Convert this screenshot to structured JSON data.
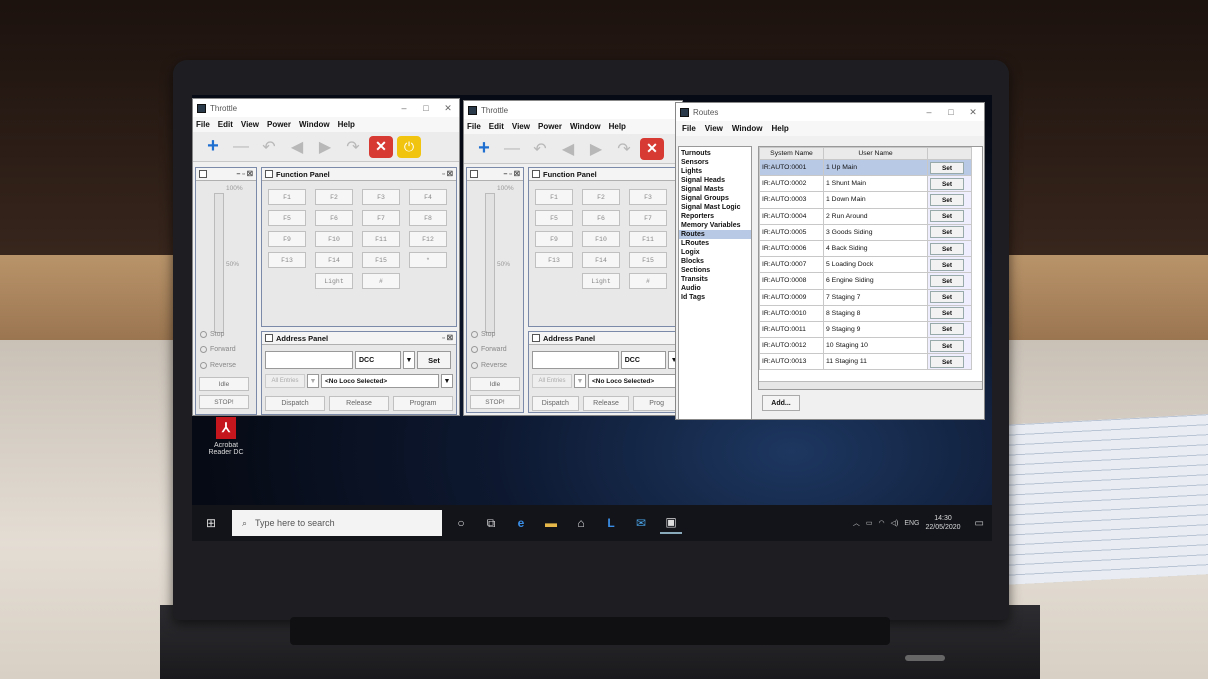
{
  "throttle1": {
    "title": "Throttle",
    "menu": [
      "File",
      "Edit",
      "View",
      "Power",
      "Window",
      "Help"
    ],
    "function_panel": {
      "title": "Function Panel",
      "buttons": [
        "F1",
        "F2",
        "F3",
        "F4",
        "F5",
        "F6",
        "F7",
        "F8",
        "F9",
        "F10",
        "F11",
        "F12",
        "F13",
        "F14",
        "F15",
        "*",
        "Light",
        "#"
      ]
    },
    "speed": {
      "top": "100%",
      "mid": "50%",
      "stop": "Stop"
    },
    "direction": {
      "forward": "Forward",
      "reverse": "Reverse"
    },
    "idle": "Idle",
    "stop_btn": "STOP!",
    "address_panel": {
      "title": "Address Panel",
      "protocol": "DCC",
      "set": "Set",
      "all_entries": "All Entries",
      "loco_select": "<No Loco Selected>",
      "dispatch": "Dispatch",
      "release": "Release",
      "program": "Program"
    }
  },
  "throttle2": {
    "title": "Throttle",
    "menu": [
      "File",
      "Edit",
      "View",
      "Power",
      "Window",
      "Help"
    ],
    "function_panel": {
      "title": "Function Panel",
      "buttons": [
        "F1",
        "F2",
        "F3",
        "F5",
        "F6",
        "F7",
        "F9",
        "F10",
        "F11",
        "F13",
        "F14",
        "F15",
        "Light",
        "#"
      ]
    },
    "speed": {
      "top": "100%",
      "mid": "50%",
      "stop": "Stop"
    },
    "direction": {
      "forward": "Forward",
      "reverse": "Reverse"
    },
    "idle": "Idle",
    "stop_btn": "STOP!",
    "address_panel": {
      "title": "Address Panel",
      "protocol": "DCC",
      "all_entries": "All Entries",
      "loco_select": "<No Loco Selected>",
      "dispatch": "Dispatch",
      "release": "Release",
      "program": "Prog"
    }
  },
  "routes": {
    "title": "Routes",
    "menu": [
      "File",
      "View",
      "Window",
      "Help"
    ],
    "nav": [
      "Turnouts",
      "Sensors",
      "Lights",
      "Signal Heads",
      "Signal Masts",
      "Signal Groups",
      "Signal Mast Logic",
      "Reporters",
      "Memory Variables",
      "Routes",
      "LRoutes",
      "Logix",
      "Blocks",
      "Sections",
      "Transits",
      "Audio",
      "Id Tags"
    ],
    "nav_selected": "Routes",
    "columns": [
      "System Name",
      "User Name"
    ],
    "set_label": "Set",
    "rows": [
      {
        "sys": "IR:AUTO:0001",
        "user": "1 Up Main"
      },
      {
        "sys": "IR:AUTO:0002",
        "user": "1 Shunt Main"
      },
      {
        "sys": "IR:AUTO:0003",
        "user": "1 Down Main"
      },
      {
        "sys": "IR:AUTO:0004",
        "user": "2 Run Around"
      },
      {
        "sys": "IR:AUTO:0005",
        "user": "3 Goods Siding"
      },
      {
        "sys": "IR:AUTO:0006",
        "user": "4 Back Siding"
      },
      {
        "sys": "IR:AUTO:0007",
        "user": "5 Loading Dock"
      },
      {
        "sys": "IR:AUTO:0008",
        "user": "6 Engine Siding"
      },
      {
        "sys": "IR:AUTO:0009",
        "user": "7 Staging 7"
      },
      {
        "sys": "IR:AUTO:0010",
        "user": "8 Staging 8"
      },
      {
        "sys": "IR:AUTO:0011",
        "user": "9 Staging 9"
      },
      {
        "sys": "IR:AUTO:0012",
        "user": "10 Staging 10"
      },
      {
        "sys": "IR:AUTO:0013",
        "user": "11 Staging 11"
      }
    ],
    "add": "Add..."
  },
  "desktop": {
    "icon_label_1": "Acrobat",
    "icon_label_2": "Reader DC"
  },
  "taskbar": {
    "search_placeholder": "Type here to search",
    "lang": "ENG",
    "time": "14:30",
    "date": "22/05/2020"
  }
}
